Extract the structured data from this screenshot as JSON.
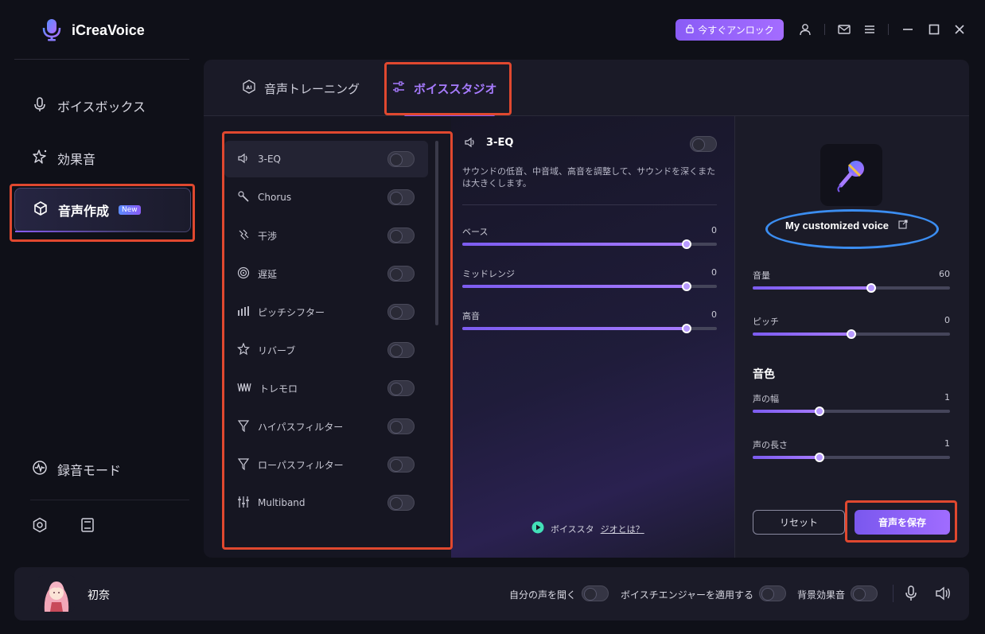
{
  "app": {
    "name": "iCreaVoice"
  },
  "titlebar": {
    "unlock_label": "今すぐアンロック",
    "icons": [
      "lock-icon",
      "user-icon",
      "mail-icon",
      "menu-icon",
      "minimize-icon",
      "maximize-icon",
      "close-icon"
    ]
  },
  "sidebar": {
    "items": [
      {
        "label": "ボイスボックス",
        "icon": "microphone-icon"
      },
      {
        "label": "効果音",
        "icon": "sparkle-icon"
      },
      {
        "label": "音声作成",
        "icon": "cube-icon",
        "badge": "New",
        "active": true
      },
      {
        "label": "録音モード",
        "icon": "waveform-icon"
      }
    ],
    "bottom_icons": [
      "settings-icon",
      "book-icon"
    ]
  },
  "tabs": [
    {
      "label": "音声トレーニング",
      "icon": "ai-icon"
    },
    {
      "label": "ボイススタジオ",
      "icon": "sliders-icon",
      "active": true
    }
  ],
  "effects": {
    "items": [
      {
        "label": "3-EQ",
        "icon": "speaker-icon",
        "selected": true
      },
      {
        "label": "Chorus",
        "icon": "chorus-icon"
      },
      {
        "label": "干渉",
        "icon": "interference-icon"
      },
      {
        "label": "遅延",
        "icon": "delay-icon"
      },
      {
        "label": "ピッチシフター",
        "icon": "bars-icon"
      },
      {
        "label": "リバーブ",
        "icon": "reverb-icon"
      },
      {
        "label": "トレモロ",
        "icon": "tremolo-icon"
      },
      {
        "label": "ハイパスフィルター",
        "icon": "highpass-icon"
      },
      {
        "label": "ローパスフィルター",
        "icon": "lowpass-icon"
      },
      {
        "label": "Multiband",
        "icon": "multiband-icon"
      }
    ]
  },
  "detail": {
    "title": "3-EQ",
    "description": "サウンドの低音、中音域、高音を調整して、サウンドを深くまたは大きくします。",
    "sliders": [
      {
        "label": "ベース",
        "value": "0",
        "fraction": 0.88
      },
      {
        "label": "ミッドレンジ",
        "value": "0",
        "fraction": 0.88
      },
      {
        "label": "高音",
        "value": "0",
        "fraction": 0.88
      }
    ],
    "help_prefix": "ボイススタ",
    "help_link": "ジオとは？"
  },
  "voice": {
    "name": "My customized voice",
    "sliders": [
      {
        "label": "音量",
        "value": "60",
        "fraction": 0.6
      },
      {
        "label": "ピッチ",
        "value": "0",
        "fraction": 0.5
      }
    ],
    "timbre_title": "音色",
    "timbre_sliders": [
      {
        "label": "声の幅",
        "value": "1",
        "fraction": 0.34
      },
      {
        "label": "声の長さ",
        "value": "1",
        "fraction": 0.34
      }
    ],
    "reset_label": "リセット",
    "save_label": "音声を保存"
  },
  "bottombar": {
    "character_name": "初奈",
    "toggles": [
      {
        "label": "自分の声を聞く"
      },
      {
        "label": "ボイスチエンジャーを適用する"
      },
      {
        "label": "背景効果音"
      }
    ]
  },
  "colors": {
    "accent": "#8a5cf6",
    "highlight_red": "#e0482f",
    "highlight_blue": "#3b8df0"
  }
}
